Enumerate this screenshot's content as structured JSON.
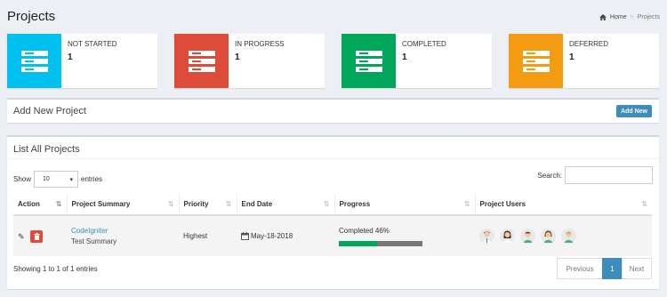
{
  "header": {
    "title": "Projects"
  },
  "breadcrumb": {
    "home": "Home",
    "sep": ">",
    "current": "Projects"
  },
  "stats": [
    {
      "label": "NOT STARTED",
      "value": "1",
      "color": "#00c0ef"
    },
    {
      "label": "IN PROGRESS",
      "value": "1",
      "color": "#dd4b39"
    },
    {
      "label": "COMPLETED",
      "value": "1",
      "color": "#00a65a"
    },
    {
      "label": "DEFERRED",
      "value": "1",
      "color": "#f39c12"
    }
  ],
  "add_panel": {
    "title": "Add New Project",
    "button": "Add New"
  },
  "list_panel": {
    "title": "List All Projects",
    "show_label": "Show",
    "entries_value": "10",
    "entries_label": "entries",
    "search_label": "Search:",
    "columns": [
      "Action",
      "Project Summary",
      "Priority",
      "End Date",
      "Progress",
      "Project Users"
    ],
    "rows": [
      {
        "summary_title": "CodeIgniter",
        "summary_sub": "Test Summary",
        "priority": "Highest",
        "end_date": "May-18-2018",
        "progress_text": "Completed 46%",
        "progress": 46
      }
    ],
    "footer": "Showing 1 to 1 of 1 entries",
    "pager": {
      "prev": "Previous",
      "page": "1",
      "next": "Next"
    }
  }
}
